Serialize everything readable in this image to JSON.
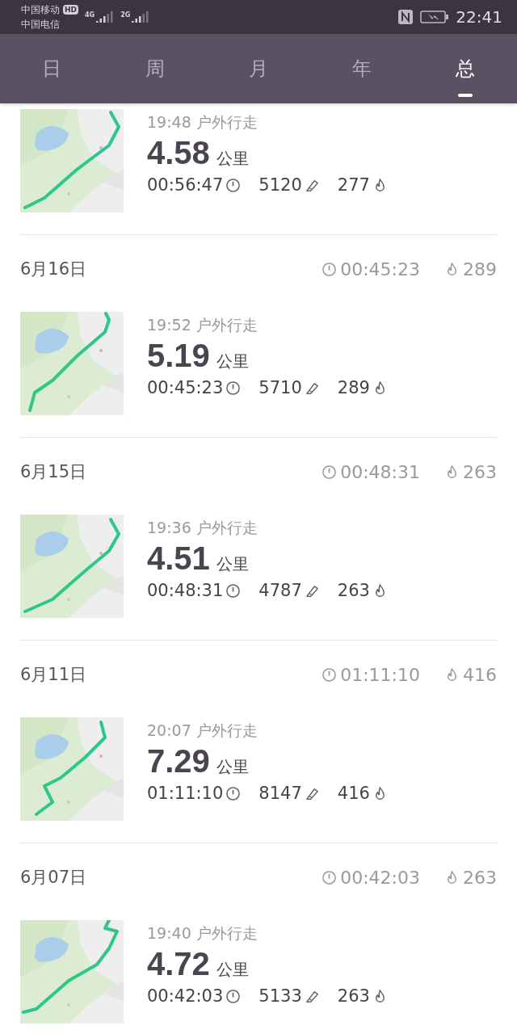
{
  "status_bar": {
    "carrier_1": "中国移动",
    "hd_badge": "HD",
    "network_1": "4G",
    "carrier_2": "中国电信",
    "network_2": "2G",
    "time": "22:41"
  },
  "tabs": [
    {
      "label": "日",
      "selected": false
    },
    {
      "label": "周",
      "selected": false
    },
    {
      "label": "月",
      "selected": false
    },
    {
      "label": "年",
      "selected": false
    },
    {
      "label": "总",
      "selected": true
    }
  ],
  "days": [
    {
      "activities": [
        {
          "time": "19:48",
          "type": "户外行走",
          "distance": "4.58",
          "unit": "公里",
          "duration": "00:56:47",
          "steps": "5120",
          "calories": "277"
        }
      ]
    },
    {
      "date": "6月16日",
      "duration": "00:45:23",
      "calories": "289",
      "activities": [
        {
          "time": "19:52",
          "type": "户外行走",
          "distance": "5.19",
          "unit": "公里",
          "duration": "00:45:23",
          "steps": "5710",
          "calories": "289"
        }
      ]
    },
    {
      "date": "6月15日",
      "duration": "00:48:31",
      "calories": "263",
      "activities": [
        {
          "time": "19:36",
          "type": "户外行走",
          "distance": "4.51",
          "unit": "公里",
          "duration": "00:48:31",
          "steps": "4787",
          "calories": "263"
        }
      ]
    },
    {
      "date": "6月11日",
      "duration": "01:11:10",
      "calories": "416",
      "activities": [
        {
          "time": "20:07",
          "type": "户外行走",
          "distance": "7.29",
          "unit": "公里",
          "duration": "01:11:10",
          "steps": "8147",
          "calories": "416"
        }
      ]
    },
    {
      "date": "6月07日",
      "duration": "00:42:03",
      "calories": "263",
      "activities": [
        {
          "time": "19:40",
          "type": "户外行走",
          "distance": "4.72",
          "unit": "公里",
          "duration": "00:42:03",
          "steps": "5133",
          "calories": "263"
        }
      ]
    }
  ]
}
